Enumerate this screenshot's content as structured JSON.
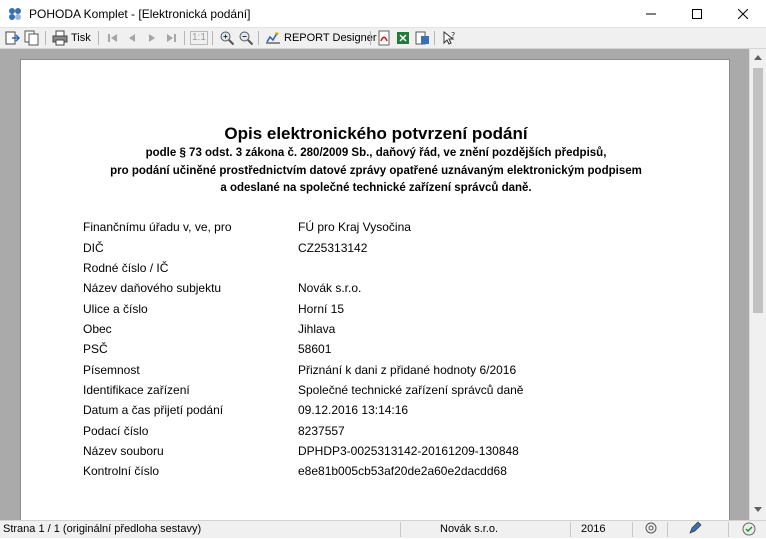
{
  "window": {
    "title": "POHODA Komplet - [Elektronická podání]"
  },
  "toolbar": {
    "print_label": "Tisk",
    "zoom_label": "1:1",
    "report_designer_label": "REPORT Designer"
  },
  "document": {
    "title": "Opis elektronického potvrzení podání",
    "subtitle_lines": [
      "podle § 73 odst. 3 zákona č. 280/2009 Sb., daňový řád, ve znění pozdějších předpisů,",
      "pro podání učiněné prostřednictvím datové zprávy opatřené uznávaným elektronickým podpisem",
      "a odeslané na společné technické zařízení správců daně."
    ],
    "rows": [
      {
        "label": "Finančnímu úřadu v, ve, pro",
        "value": "FÚ pro Kraj Vysočina"
      },
      {
        "label": "DIČ",
        "value": "CZ25313142"
      },
      {
        "label": "Rodné číslo / IČ",
        "value": ""
      },
      {
        "label": "Název daňového subjektu",
        "value": "Novák s.r.o."
      },
      {
        "label": "Ulice a číslo",
        "value": "Horní 15"
      },
      {
        "label": "Obec",
        "value": "Jihlava"
      },
      {
        "label": "PSČ",
        "value": "58601"
      },
      {
        "label": "Písemnost",
        "value": "Přiznání k dani z přidané hodnoty 6/2016"
      },
      {
        "label": "Identifikace zařízení",
        "value": "Společné technické zařízení správců daně"
      },
      {
        "label": "Datum a čas přijetí podání",
        "value": "09.12.2016 13:14:16"
      },
      {
        "label": "Podací číslo",
        "value": "8237557"
      },
      {
        "label": "Název souboru",
        "value": "DPHDP3-0025313142-20161209-130848"
      },
      {
        "label": "Kontrolní číslo",
        "value": "e8e81b005cb53af20de2a60e2dacdd68"
      }
    ]
  },
  "statusbar": {
    "page_info": "Strana 1 / 1  (originální předloha sestavy)",
    "company": "Novák s.r.o.",
    "year": "2016"
  }
}
